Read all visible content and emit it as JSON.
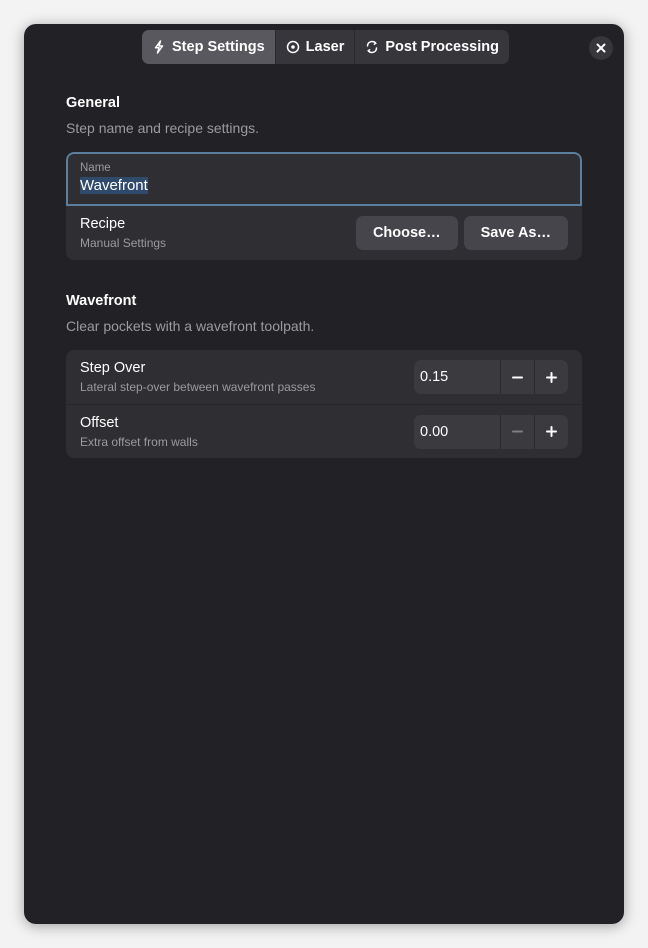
{
  "header": {
    "tabs": [
      {
        "label": "Step Settings",
        "icon": "bolt-icon",
        "active": true
      },
      {
        "label": "Laser",
        "icon": "laser-target-icon",
        "active": false
      },
      {
        "label": "Post Processing",
        "icon": "post-process-icon",
        "active": false
      }
    ],
    "close_icon": "close-icon"
  },
  "general": {
    "title": "General",
    "description": "Step name and recipe settings.",
    "name_label": "Name",
    "name_value": "Wavefront",
    "recipe_title": "Recipe",
    "recipe_subtitle": "Manual Settings",
    "choose_label": "Choose…",
    "save_as_label": "Save As…"
  },
  "wavefront": {
    "title": "Wavefront",
    "description": "Clear pockets with a wavefront toolpath.",
    "params": [
      {
        "title": "Step Over",
        "subtitle": "Lateral step-over between wavefront passes",
        "value": "0.15"
      },
      {
        "title": "Offset",
        "subtitle": "Extra offset from walls",
        "value": "0.00"
      }
    ]
  },
  "colors": {
    "window_bg": "#222226",
    "group_bg": "#2e2e33",
    "focus_border": "#5b7f9c",
    "selection": "#2f4a6b"
  }
}
